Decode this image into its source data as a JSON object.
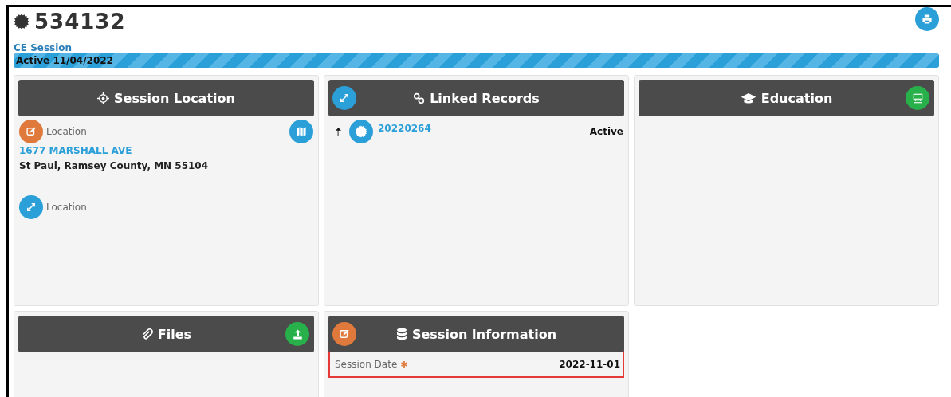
{
  "record": {
    "number": "534132",
    "type": "CE Session",
    "status": "Active 11/04/2022"
  },
  "panels": [
    {
      "kind": "location",
      "title": "Session Location",
      "label": "Location",
      "street": "1677 MARSHALL AVE",
      "city": "St Paul, Ramsey County, MN 55104",
      "expand_label": "Location"
    },
    {
      "kind": "linked",
      "title": "Linked Records",
      "records": [
        {
          "number": "20220264",
          "status": "Active"
        }
      ]
    },
    {
      "kind": "education",
      "title": "Education"
    },
    {
      "kind": "files",
      "title": "Files"
    },
    {
      "kind": "info",
      "title": "Session Information",
      "fields": [
        {
          "label": "Session Date",
          "required_mark": "✱",
          "value": "2022-11-01",
          "highlighted": true
        }
      ]
    }
  ]
}
